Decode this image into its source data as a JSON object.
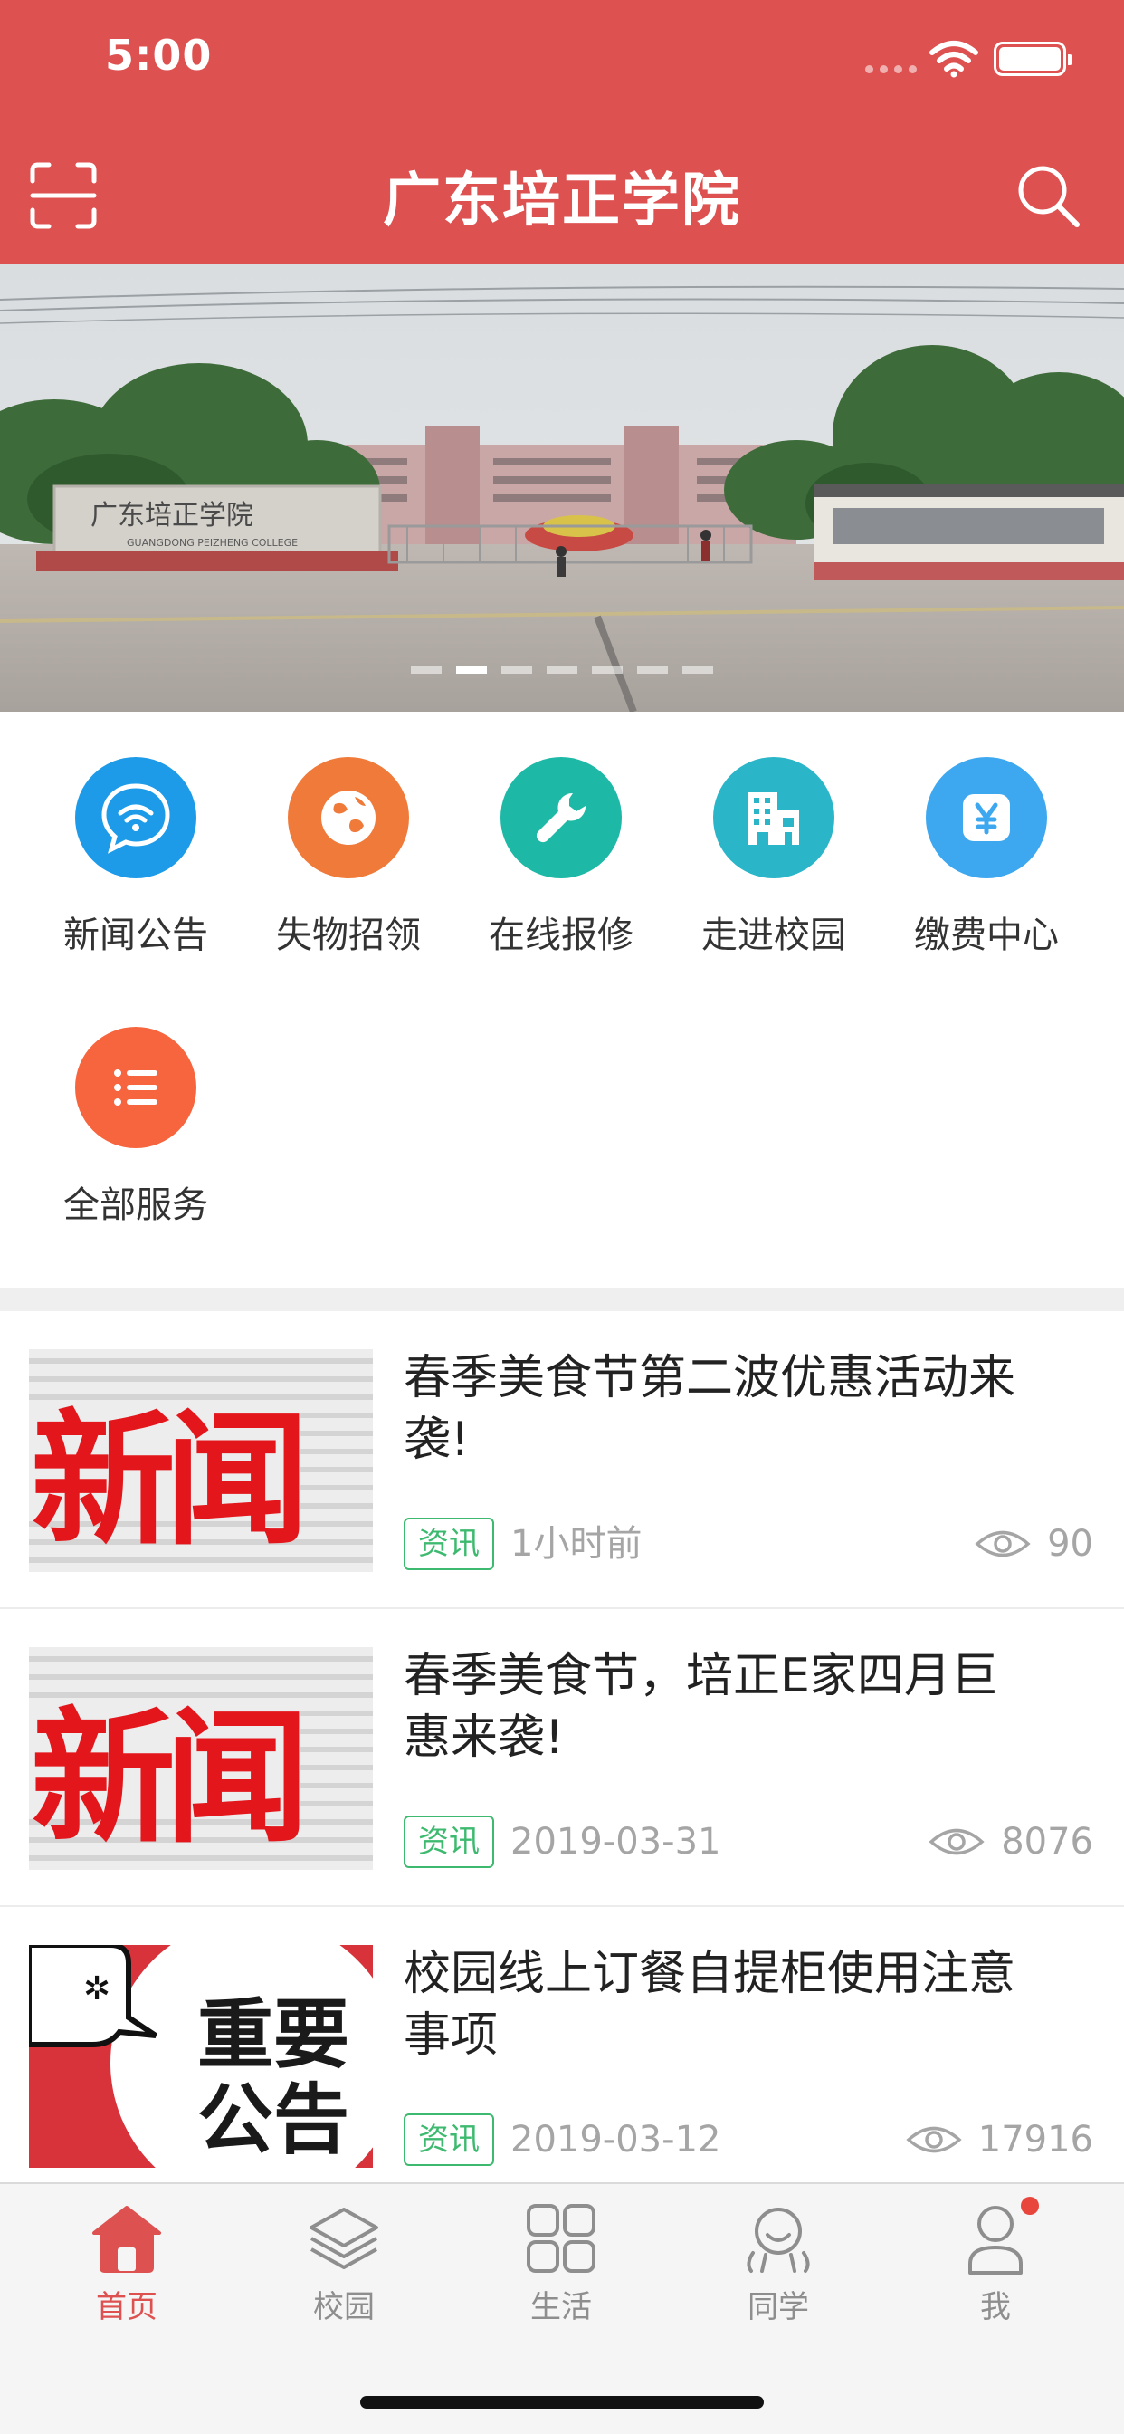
{
  "status_bar": {
    "time": "5:00"
  },
  "header": {
    "title": "广东培正学院"
  },
  "banner": {
    "sign_text": "广东培正学院",
    "sign_subtext": "GUANGDONG PEIZHENG COLLEGE",
    "page_count": 7,
    "active_index": 1
  },
  "services": [
    {
      "label": "新闻公告",
      "icon": "chat-wifi-icon",
      "color": "#1E9BE8"
    },
    {
      "label": "失物招领",
      "icon": "globe-icon",
      "color": "#F07A3A"
    },
    {
      "label": "在线报修",
      "icon": "wrench-icon",
      "color": "#1EB8A6"
    },
    {
      "label": "走进校园",
      "icon": "building-icon",
      "color": "#2AB5C8"
    },
    {
      "label": "缴费中心",
      "icon": "yen-icon",
      "color": "#3DA8F0"
    },
    {
      "label": "全部服务",
      "icon": "list-icon",
      "color": "#F7653F"
    }
  ],
  "news": [
    {
      "title": "春季美食节第二波优惠活动来袭!",
      "tag": "资讯",
      "date": "1小时前",
      "views": "90",
      "thumb_text": "新闻"
    },
    {
      "title": "春季美食节，培正E家四月巨惠来袭!",
      "tag": "资讯",
      "date": "2019-03-31",
      "views": "8076",
      "thumb_text": "新闻"
    },
    {
      "title": "校园线上订餐自提柜使用注意事项",
      "tag": "资讯",
      "date": "2019-03-12",
      "views": "17916",
      "thumb_text_1": "重要",
      "thumb_text_2": "公告"
    }
  ],
  "tabbar": {
    "items": [
      {
        "label": "首页",
        "icon": "home-icon",
        "active": true
      },
      {
        "label": "校园",
        "icon": "layers-icon",
        "active": false
      },
      {
        "label": "生活",
        "icon": "grid-icon",
        "active": false
      },
      {
        "label": "同学",
        "icon": "classmate-icon",
        "active": false
      },
      {
        "label": "我",
        "icon": "user-icon",
        "active": false,
        "badge": true
      }
    ]
  },
  "colors": {
    "brand": "#DD5150",
    "tag_green": "#3DBA6F",
    "muted": "#A5A5A5"
  }
}
